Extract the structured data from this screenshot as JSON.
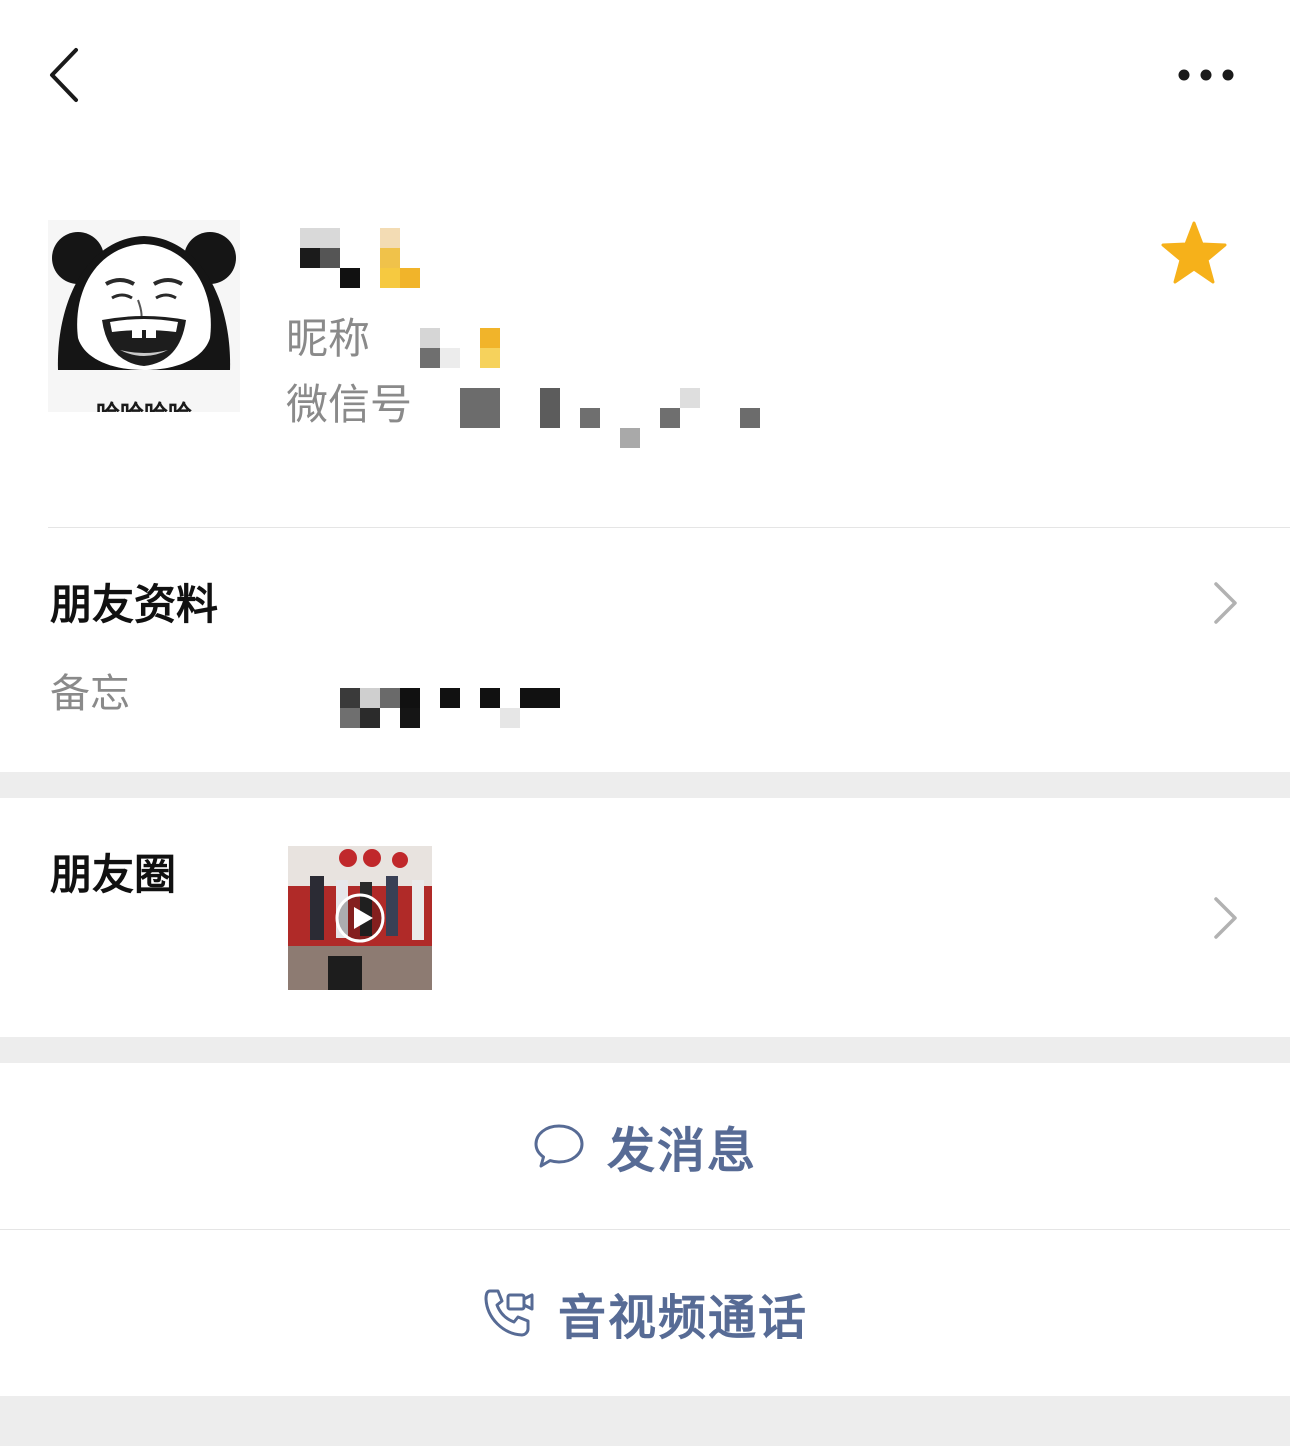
{
  "top_bar": {
    "back_icon": "chevron-left-icon",
    "more_icon": "more-dots-icon"
  },
  "profile": {
    "avatar_caption": "哈哈哈哈",
    "nickname_label": "昵称",
    "wechat_id_label": "微信号",
    "star_icon": "star-icon",
    "star_color": "#f6b11a"
  },
  "friend_info": {
    "title": "朋友资料",
    "memo_label": "备忘"
  },
  "moments": {
    "title": "朋友圈",
    "thumbnail_icon": "video-play-icon"
  },
  "actions": {
    "message_label": "发消息",
    "message_icon": "chat-bubble-icon",
    "call_label": "音视频通话",
    "call_icon": "phone-video-icon",
    "accent_color": "#576b95"
  }
}
